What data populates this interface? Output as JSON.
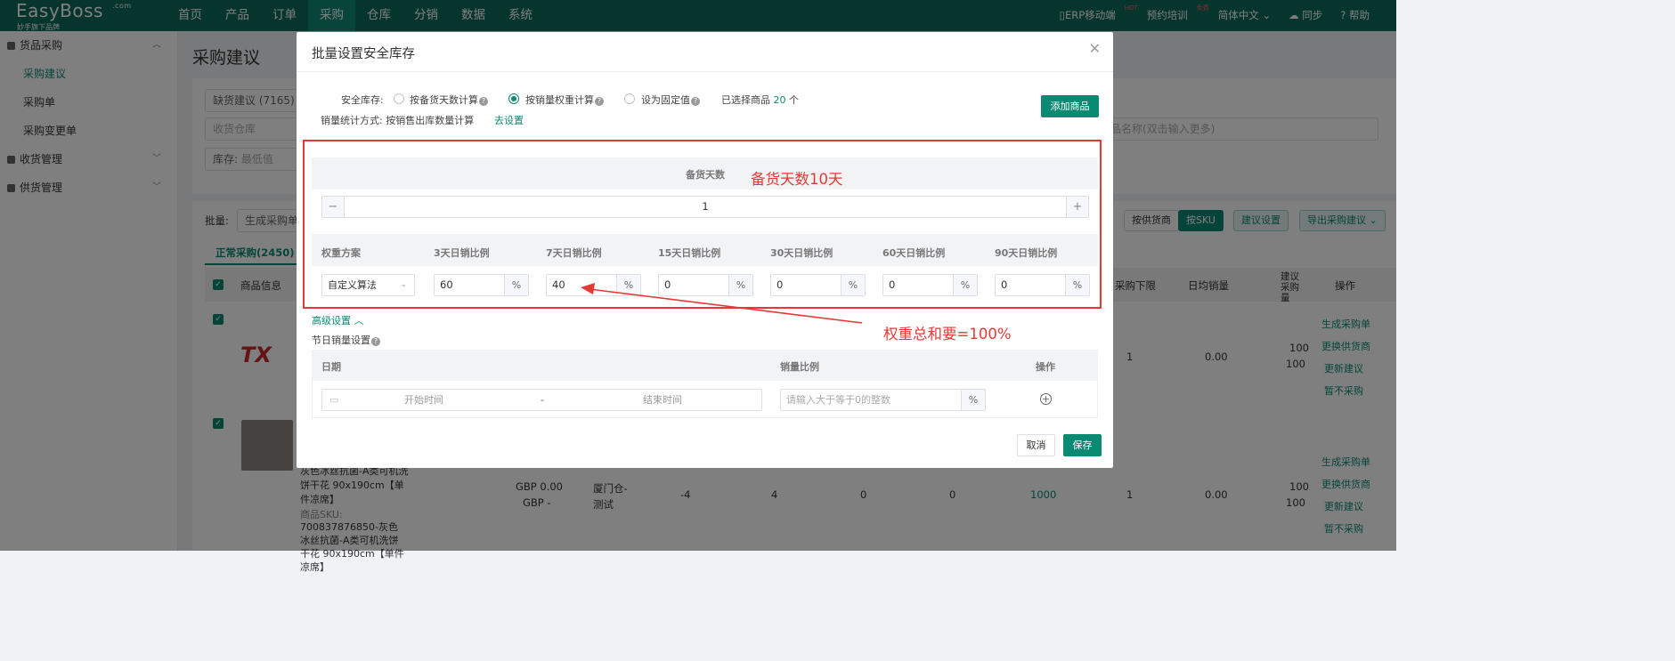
{
  "app": {
    "logo": "EasyBoss",
    "logo_com": ".com",
    "logo_sub": "妙手旗下品牌"
  },
  "nav": [
    "首页",
    "产品",
    "订单",
    "采购",
    "仓库",
    "分销",
    "数据",
    "系统"
  ],
  "topright": {
    "erp": "ERP移动端",
    "erp_badge": "HOT",
    "training": "预约培训",
    "training_badge": "免费",
    "lang": "简体中文",
    "sync": "同步",
    "help": "帮助"
  },
  "sidebar": {
    "group1": "货品采购",
    "items": [
      "采购建议",
      "采购单",
      "采购变更单"
    ],
    "group2": "收货管理",
    "group3": "供货管理"
  },
  "page": {
    "title": "采购建议",
    "filter_status": "缺货建议 (7165)",
    "filter_warehouse": "收货仓库",
    "filter_stock": "库存:",
    "filter_stock_min": "最低值",
    "filter_name_ph": "品名称(双击输入更多)",
    "batch": "批量:",
    "batch_select": "生成采购单",
    "tab_normal": "正常采购(2450)",
    "btn_by_supplier": "按供货商",
    "btn_by_sku": "按SKU",
    "btn_suggest_settings": "建议设置",
    "btn_export": "导出采购建议",
    "cols": {
      "info": "商品信息",
      "lower": "采购下限",
      "daily": "日均销量",
      "suggest": "建议采购量",
      "ops": "操作"
    },
    "row1": {
      "lower": "1",
      "daily": "0.00",
      "suggest": "100",
      "suggest2": "100"
    },
    "row2": {
      "title": "灰色冰丝抗菌-A类可机洗饼干花 90x190cm【单件凉席】",
      "sku_label": "商品SKU:",
      "sku": "700837876850-灰色冰丝抗菌-A类可机洗饼干花 90x190cm【单件凉席】",
      "price1": "GBP 0.00",
      "price2": "GBP -",
      "warehouse": "厦门仓-测试",
      "n1": "-4",
      "n2": "4",
      "n3": "0",
      "n4": "0",
      "n5": "1000",
      "lower": "1",
      "daily": "0.00",
      "suggest": "100",
      "suggest2": "100"
    },
    "ops": [
      "生成采购单",
      "更换供货商",
      "更新建议",
      "暂不采购"
    ]
  },
  "modal": {
    "title": "批量设置安全库存",
    "safe_stock_label": "安全库存:",
    "options": [
      "按备货天数计算",
      "按销量权重计算",
      "设为固定值"
    ],
    "selected_prefix": "已选择商品",
    "selected_count": "20",
    "selected_suffix": "个",
    "stat_label": "销量统计方式:",
    "stat_value": "按销售出库数量计算",
    "stat_link": "去设置",
    "add_btn": "添加商品",
    "stock_days_header": "备货天数",
    "stock_days_value": "1",
    "weight_headers": [
      "权重方案",
      "3天日销比例",
      "7天日销比例",
      "15天日销比例",
      "30天日销比例",
      "60天日销比例",
      "90天日销比例"
    ],
    "scheme_value": "自定义算法",
    "weights": [
      "60",
      "40",
      "0",
      "0",
      "0",
      "0"
    ],
    "unit": "%",
    "advanced": "高级设置",
    "holiday_label": "节日销量设置",
    "holiday_cols": [
      "日期",
      "销量比例",
      "操作"
    ],
    "start_ph": "开始时间",
    "end_ph": "结束时间",
    "ratio_ph": "请输入大于等于0的整数",
    "cancel": "取消",
    "save": "保存"
  },
  "annotations": {
    "days": "备货天数10天",
    "weights": "权重总和要=100%"
  },
  "colors": {
    "brand": "#0b6b5b",
    "accent": "#0b8a73",
    "annotation": "#e53935"
  }
}
